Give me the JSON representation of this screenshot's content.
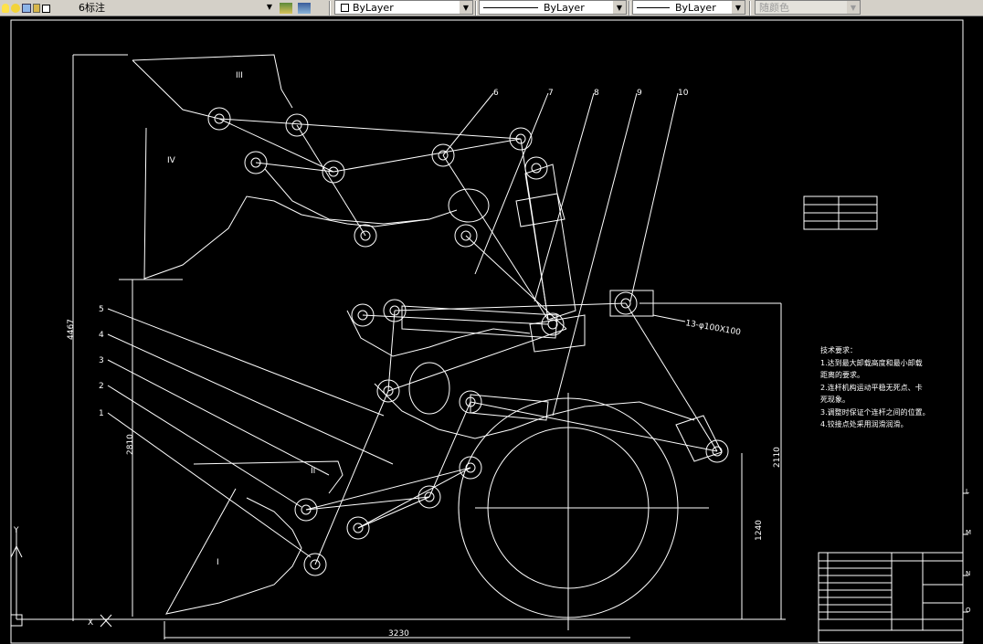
{
  "toolbar": {
    "layer_name": "6标注",
    "color_value": "ByLayer",
    "linetype_value": "ByLayer",
    "lineweight_value": "ByLayer",
    "plotstyle_value": "随颜色"
  },
  "drawing": {
    "zone_labels": [
      "III",
      "IV",
      "II",
      "I"
    ],
    "callouts": [
      "6",
      "7",
      "8",
      "9",
      "10"
    ],
    "left_callouts": [
      "5",
      "4",
      "3",
      "2",
      "1"
    ],
    "dimensions": {
      "height_total": "4467",
      "height_left": "2810",
      "height_right": "2110",
      "height_wheel": "1240",
      "width_bottom": "3230"
    },
    "cylinder_annotation": "13-φ100X100",
    "tech_requirements": [
      "技术要求：",
      "1.达到最大卸载高度和最小卸载",
      "距离的要求。",
      "2.连杆机构运动平稳无死点、卡",
      "死现象。",
      "3.调整时保证个连杆之间的位置。",
      "4.铰接点处采用润滑润滑。"
    ],
    "axis_y": "Y",
    "axis_x": "X",
    "side_ticks": [
      "L",
      "M",
      "N",
      "O"
    ]
  },
  "colors": {
    "canvas_bg": "#000000",
    "line": "#ffffff",
    "toolbar_bg": "#d4d0c8"
  }
}
